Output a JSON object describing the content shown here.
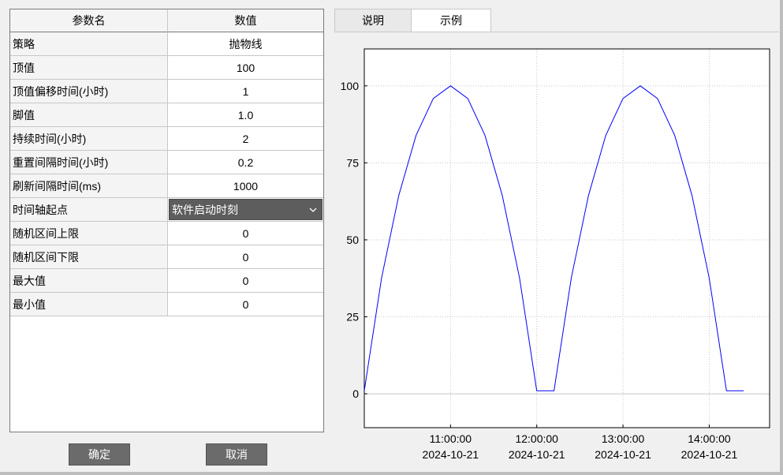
{
  "table": {
    "headers": {
      "name": "参数名",
      "value": "数值"
    },
    "rows": [
      {
        "name": "策略",
        "value": "抛物线"
      },
      {
        "name": "顶值",
        "value": "100"
      },
      {
        "name": "顶值偏移时间(小时)",
        "value": "1"
      },
      {
        "name": "脚值",
        "value": "1.0"
      },
      {
        "name": "持续时间(小时)",
        "value": "2"
      },
      {
        "name": "重置间隔时间(小时)",
        "value": "0.2"
      },
      {
        "name": "刷新间隔时间(ms)",
        "value": "1000"
      },
      {
        "name": "时间轴起点",
        "value": "软件启动时刻"
      },
      {
        "name": "随机区间上限",
        "value": "0"
      },
      {
        "name": "随机区间下限",
        "value": "0"
      },
      {
        "name": "最大值",
        "value": "0"
      },
      {
        "name": "最小值",
        "value": "0"
      }
    ]
  },
  "buttons": {
    "ok": "确定",
    "cancel": "取消"
  },
  "tabs": [
    {
      "label": "说明"
    },
    {
      "label": "示例"
    }
  ],
  "active_tab": "示例",
  "chart_data": {
    "type": "line",
    "title": "",
    "xlabel": "",
    "ylabel": "",
    "x_ticks": [
      {
        "time": "11:00:00",
        "date": "2024-10-21"
      },
      {
        "time": "12:00:00",
        "date": "2024-10-21"
      },
      {
        "time": "13:00:00",
        "date": "2024-10-21"
      },
      {
        "time": "14:00:00",
        "date": "2024-10-21"
      }
    ],
    "xlim": [
      "2024-10-21 10:00:00",
      "2024-10-21 14:42:00"
    ],
    "y_ticks": [
      0,
      25,
      50,
      75,
      100
    ],
    "ylim": [
      -11,
      112
    ],
    "grid": true,
    "line_color": "#0000ff",
    "series": [
      {
        "points": [
          {
            "x": "2024-10-21 10:00:00",
            "y": 1.0
          },
          {
            "x": "2024-10-21 10:12:00",
            "y": 37.6
          },
          {
            "x": "2024-10-21 10:24:00",
            "y": 64.4
          },
          {
            "x": "2024-10-21 10:36:00",
            "y": 83.9
          },
          {
            "x": "2024-10-21 10:48:00",
            "y": 95.9
          },
          {
            "x": "2024-10-21 11:00:00",
            "y": 100.0
          },
          {
            "x": "2024-10-21 11:12:00",
            "y": 95.9
          },
          {
            "x": "2024-10-21 11:24:00",
            "y": 83.9
          },
          {
            "x": "2024-10-21 11:36:00",
            "y": 64.4
          },
          {
            "x": "2024-10-21 11:48:00",
            "y": 37.6
          },
          {
            "x": "2024-10-21 12:00:00",
            "y": 1.0
          },
          {
            "x": "2024-10-21 12:12:00",
            "y": 1.0
          },
          {
            "x": "2024-10-21 12:24:00",
            "y": 37.6
          },
          {
            "x": "2024-10-21 12:36:00",
            "y": 64.4
          },
          {
            "x": "2024-10-21 12:48:00",
            "y": 83.9
          },
          {
            "x": "2024-10-21 13:00:00",
            "y": 95.9
          },
          {
            "x": "2024-10-21 13:12:00",
            "y": 100.0
          },
          {
            "x": "2024-10-21 13:24:00",
            "y": 95.9
          },
          {
            "x": "2024-10-21 13:36:00",
            "y": 83.9
          },
          {
            "x": "2024-10-21 13:48:00",
            "y": 64.4
          },
          {
            "x": "2024-10-21 14:00:00",
            "y": 37.6
          },
          {
            "x": "2024-10-21 14:12:00",
            "y": 1.0
          },
          {
            "x": "2024-10-21 14:24:00",
            "y": 1.0
          }
        ]
      }
    ]
  }
}
